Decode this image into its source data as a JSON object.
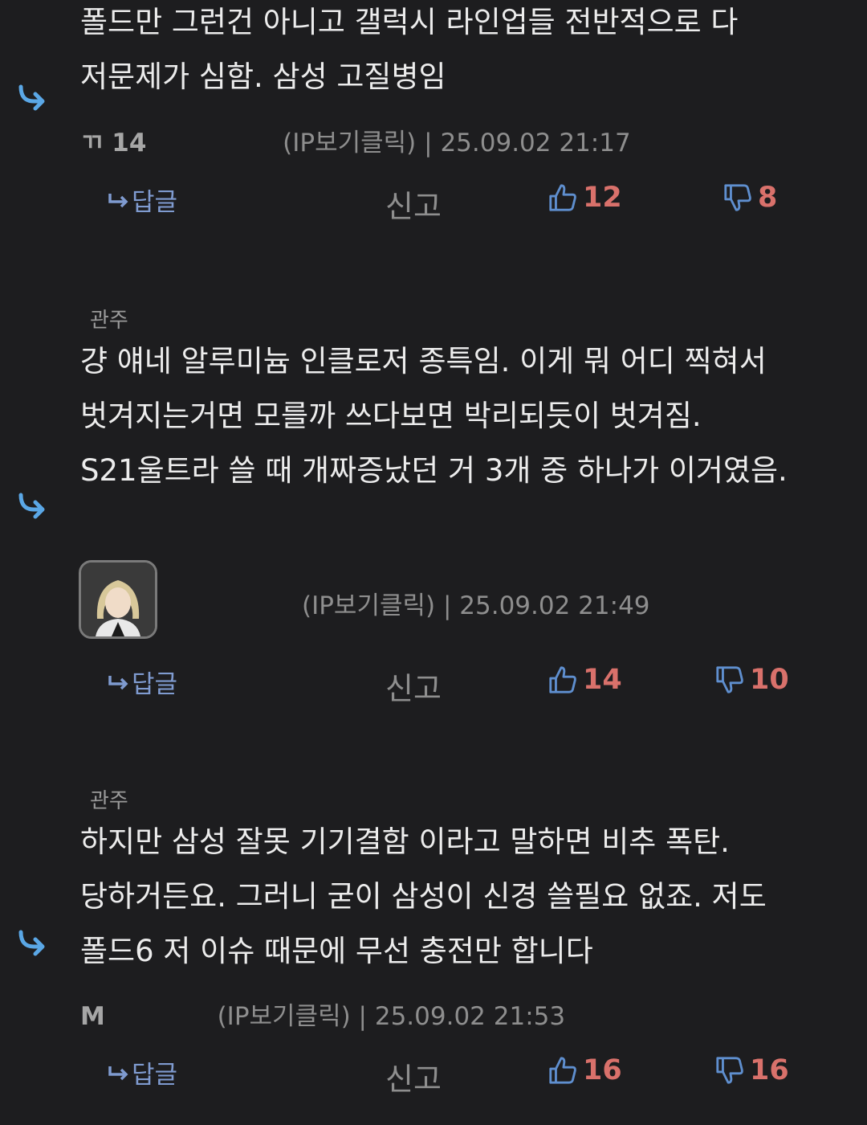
{
  "comments": [
    {
      "tag": "",
      "text": "폴드만 그런건 아니고 갤럭시 라인업들 전반적으로 다 저문제가 심함. 삼성 고질병임",
      "author": "ㄲ 14",
      "ip": "(IP보기클릭)",
      "separator": "|",
      "datetime": "25.09.02 21:17",
      "reply_label": "답글",
      "report_label": "신고",
      "likes": "12",
      "dislikes": "8"
    },
    {
      "tag": "관주",
      "text": "걍 얘네 알루미늄 인클로저 종특임. 이게 뭐 어디 찍혀서 벗겨지는거면 모를까 쓰다보면 박리되듯이 벗겨짐. S21울트라 쓸 때 개짜증났던 거 3개 중 하나가 이거였음.",
      "author": "",
      "ip": "(IP보기클릭)",
      "separator": "|",
      "datetime": "25.09.02 21:49",
      "reply_label": "답글",
      "report_label": "신고",
      "likes": "14",
      "dislikes": "10"
    },
    {
      "tag": "관주",
      "text": "하지만 삼성 잘못 기기결함 이라고 말하면 비추 폭탄. 당하거든요. 그러니 굳이 삼성이 신경 쓸필요 없죠. 저도 폴드6 저 이슈 때문에 무선 충전만 합니다",
      "author": "M",
      "ip": "(IP보기클릭)",
      "separator": "|",
      "datetime": "25.09.02 21:53",
      "reply_label": "답글",
      "report_label": "신고",
      "likes": "16",
      "dislikes": "16"
    }
  ],
  "icons": {
    "reply_arrow": "reply-arrow-icon",
    "reply_small": "reply-small-icon",
    "thumbs_up": "thumbs-up-icon",
    "thumbs_down": "thumbs-down-icon",
    "avatar": "avatar"
  },
  "colors": {
    "background": "#1d1d1f",
    "text": "#ececec",
    "meta": "#8e8e8e",
    "accent_blue": "#5aa7e6",
    "reply_blue": "#7f9bd0",
    "vote_red": "#d9716b"
  }
}
